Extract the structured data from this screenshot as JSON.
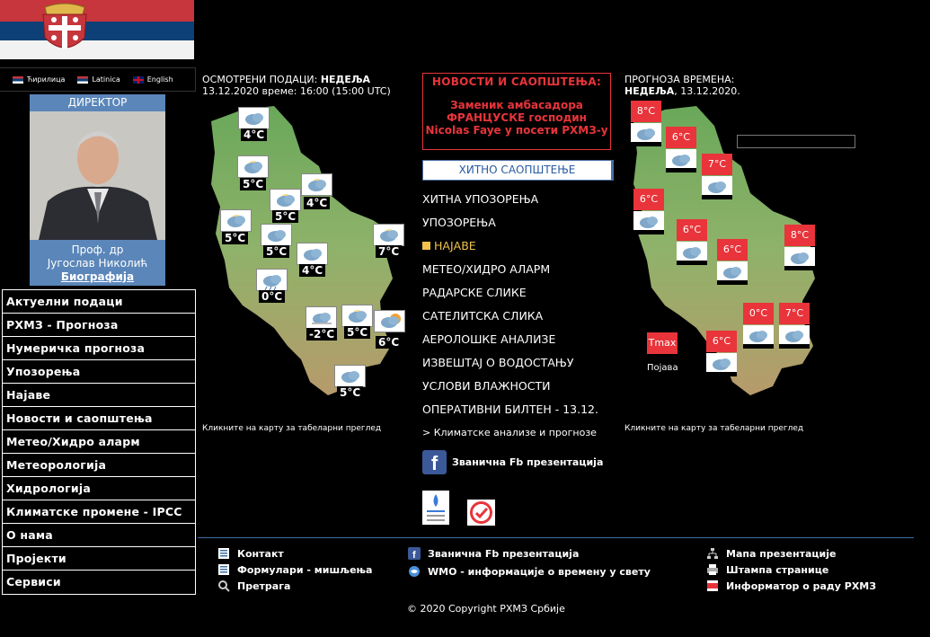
{
  "languages": [
    {
      "label": "Ћирилица"
    },
    {
      "label": "Latinica"
    },
    {
      "label": "English"
    }
  ],
  "director": {
    "title": "ДИРЕКТОР",
    "name_line1": "Проф. др",
    "name_line2": "Југослав Николић",
    "bio_link": "Биографија"
  },
  "left_nav": [
    "Актуелни подаци",
    "РХМЗ - Прогноза",
    "Нумеричка прогноза",
    "Упозорења",
    "Најаве",
    "Новости и саопштења",
    "Метео/Хидро аларм",
    "Метеорологија",
    "Хидрологија",
    "Климатске промене - IPCC",
    "О нама",
    "Пројекти",
    "Сервиси"
  ],
  "observed": {
    "label": "ОСМОТРЕНИ ПОДАЦИ:",
    "day": "НЕДЕЉА",
    "datetime": "13.12.2020 време: 16:00 (15:00 UTC)",
    "note": "Кликните на карту за табеларни преглед",
    "temps": [
      "4°C",
      "5°C",
      "5°C",
      "4°C",
      "5°C",
      "5°C",
      "4°C",
      "7°C",
      "0°C",
      "-2°C",
      "5°C",
      "6°C",
      "5°C"
    ]
  },
  "news": {
    "title": "НОВОСТИ И САОПШТЕЊА:",
    "line1": "Заменик амбасадора",
    "line2": "ФРАНЦУСКЕ господин",
    "line3": "Nicolas Faye у посети РХМЗ-у"
  },
  "urgent_button": "ХИТНО САОПШТЕЊЕ",
  "mid_nav": [
    "ХИТНА УПОЗОРЕЊА",
    "УПОЗОРЕЊА",
    "НАЈАВЕ",
    "МЕТЕО/ХИДРО АЛАРМ",
    "РАДАРСКЕ СЛИКЕ",
    "САТЕЛИТСКА СЛИКА",
    "АЕРОЛОШКЕ АНАЛИЗЕ",
    "ИЗВЕШТАЈ О ВОДОСТАЊУ",
    "УСЛОВИ ВЛАЖНОСТИ",
    "ОПЕРАТИВНИ БИЛТЕН - 13.12."
  ],
  "climate_link": "> Климатске анализе и прогнозе",
  "fb_link": "Званична Fb презентација",
  "forecast": {
    "label": "ПРОГНОЗА ВРЕМЕНА:",
    "day": "НЕДЕЉА",
    "date": ", 13.12.2020.",
    "note": "Кликните на карту за табеларни преглед",
    "temps": [
      "8°C",
      "6°C",
      "7°C",
      "6°C",
      "6°C",
      "6°C",
      "8°C",
      "0°C",
      "7°C",
      "6°C"
    ],
    "tmax": "Tmax",
    "legend": "Појава"
  },
  "footer": {
    "contact": "Контакт",
    "forms": "Формулари - мишљења",
    "search": "Претрага",
    "fb": "Званична Fb презентација",
    "wmo": "WMO - информације о времену у свету",
    "sitemap": "Мапа презентације",
    "print": "Штампа странице",
    "informator": "Информатор о раду РХМЗ",
    "copyright": "© 2020 Copyright РХМЗ Србије"
  },
  "colors": {
    "accent_red": "#e8343a",
    "nav_blue": "#5b86b9",
    "active_yellow": "#f2c14e"
  }
}
